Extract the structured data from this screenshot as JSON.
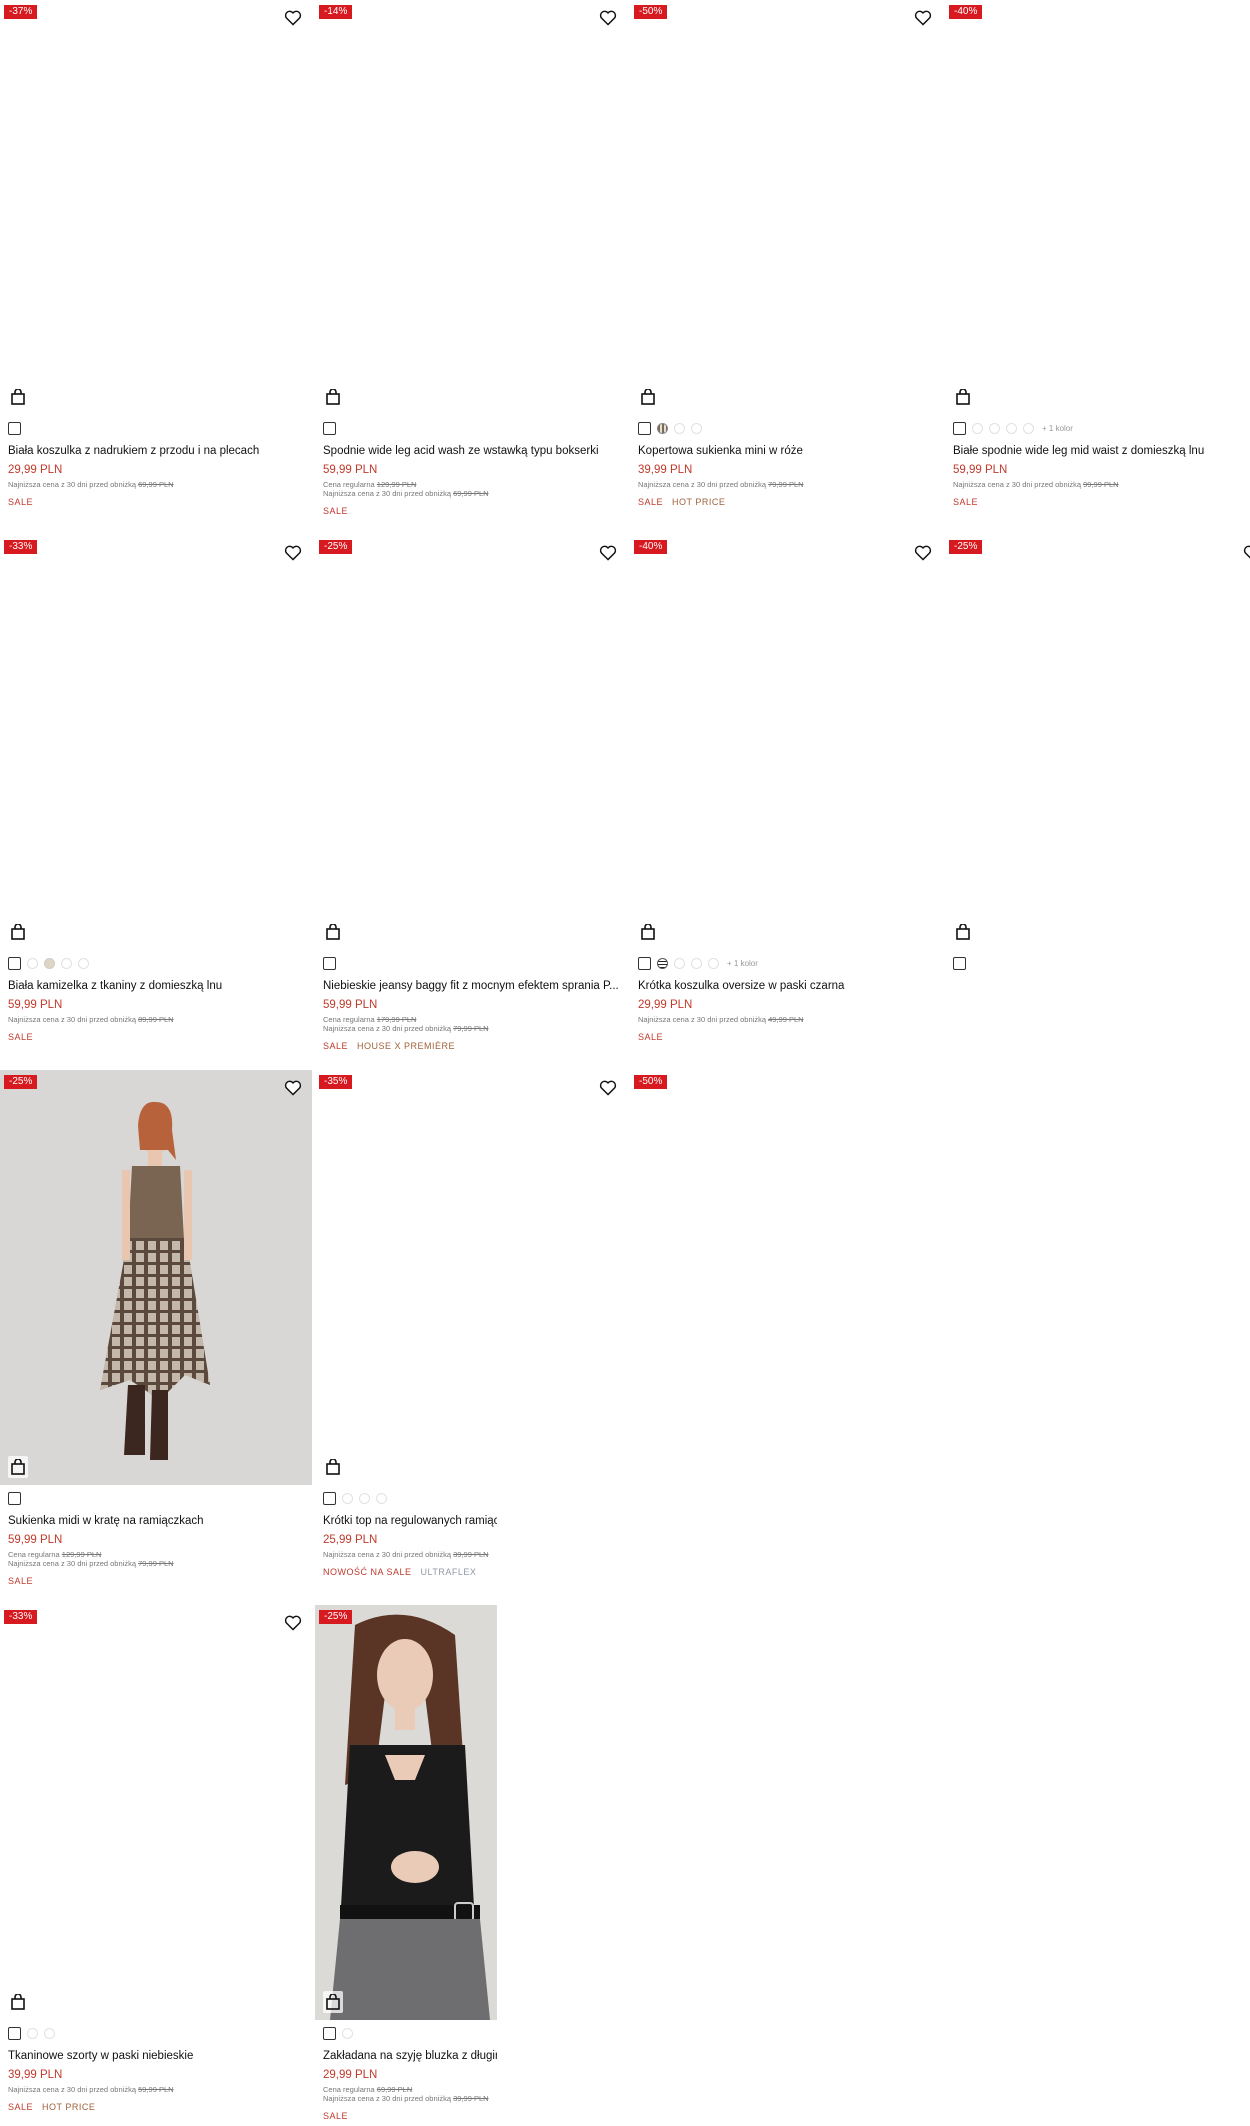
{
  "products": [
    {
      "id": "p1",
      "discount": "-37%",
      "name": "Biała koszulka z nadrukiem z przodu i na plecach",
      "price": "29,99 PLN",
      "regular": "",
      "lowest": "Najniższa cena z 30 dni przed obniżką",
      "lowest_price": "69,99 PLN",
      "more_colors": "",
      "tags": [
        "SALE"
      ]
    },
    {
      "id": "p2",
      "discount": "-14%",
      "name": "Spodnie wide leg acid wash ze wstawką typu bokserki",
      "price": "59,99 PLN",
      "regular_label": "Cena regularna",
      "regular": "129,99 PLN",
      "lowest": "Najniższa cena z 30 dni przed obniżką",
      "lowest_price": "69,99 PLN",
      "more_colors": "",
      "tags": [
        "SALE"
      ]
    },
    {
      "id": "p3",
      "discount": "-50%",
      "name": "Kopertowa sukienka mini w róże",
      "price": "39,99 PLN",
      "regular": "",
      "lowest": "Najniższa cena z 30 dni przed obniżką",
      "lowest_price": "79,99 PLN",
      "more_colors": "",
      "tags": [
        "SALE",
        "HOT PRICE"
      ]
    },
    {
      "id": "p4",
      "discount": "-40%",
      "name": "Białe spodnie wide leg mid waist z domieszką lnu",
      "price": "59,99 PLN",
      "regular": "",
      "lowest": "Najniższa cena z 30 dni przed obniżką",
      "lowest_price": "99,99 PLN",
      "more_colors": "+ 1 kolor",
      "tags": [
        "SALE"
      ]
    },
    {
      "id": "p5",
      "discount": "-33%",
      "name": "Biała kamizelka z tkaniny z domieszką lnu",
      "price": "59,99 PLN",
      "regular": "",
      "lowest": "Najniższa cena z 30 dni przed obniżką",
      "lowest_price": "89,99 PLN",
      "more_colors": "",
      "tags": [
        "SALE"
      ]
    },
    {
      "id": "p6",
      "discount": "-25%",
      "name": "Niebieskie jeansy baggy fit z mocnym efektem sprania P...",
      "price": "59,99 PLN",
      "regular_label": "Cena regularna",
      "regular": "179,99 PLN",
      "lowest": "Najniższa cena z 30 dni przed obniżką",
      "lowest_price": "79,99 PLN",
      "more_colors": "",
      "tags": [
        "SALE",
        "HOUSE X PREMIÈRE"
      ]
    },
    {
      "id": "p7",
      "discount": "-40%",
      "name": "Krótka koszulka oversize w paski czarna",
      "price": "29,99 PLN",
      "regular": "",
      "lowest": "Najniższa cena z 30 dni przed obniżką",
      "lowest_price": "49,99 PLN",
      "more_colors": "+ 1 kolor",
      "tags": [
        "SALE"
      ]
    },
    {
      "id": "p8",
      "discount": "-25%"
    },
    {
      "id": "p9",
      "discount": "-25%",
      "name": "Sukienka midi w kratę na ramiączkach",
      "price": "59,99 PLN",
      "regular_label": "Cena regularna",
      "regular": "129,99 PLN",
      "lowest": "Najniższa cena z 30 dni przed obniżką",
      "lowest_price": "79,99 PLN",
      "more_colors": "",
      "tags": [
        "SALE"
      ]
    },
    {
      "id": "p10",
      "discount": "-35%",
      "name": "Krótki top na regulowanych ramiąc",
      "price": "25,99 PLN",
      "regular": "",
      "lowest": "Najniższa cena z 30 dni przed obniżką",
      "lowest_price": "39,99 PLN",
      "more_colors": "",
      "tags": [
        "NOWOŚĆ NA SALE",
        "ULTRAFLEX"
      ]
    },
    {
      "id": "p11",
      "discount": "-50%"
    },
    {
      "id": "p12",
      "discount": "-33%",
      "name": "Tkaninowe szorty w paski niebieskie",
      "price": "39,99 PLN",
      "regular": "",
      "lowest": "Najniższa cena z 30 dni przed obniżką",
      "lowest_price": "59,99 PLN",
      "more_colors": "",
      "tags": [
        "SALE",
        "HOT PRICE"
      ]
    },
    {
      "id": "p13",
      "discount": "-25%",
      "name": "Zakładana na szyję bluzka z długim",
      "price": "29,99 PLN",
      "regular_label": "Cena regularna",
      "regular": "69,99 PLN",
      "lowest": "Najniższa cena z 30 dni przed obniżką",
      "lowest_price": "39,99 PLN",
      "more_colors": "",
      "tags": [
        "SALE"
      ]
    }
  ],
  "colors": {
    "sale_red": "#d71920",
    "price_red": "#c0392b",
    "brown_tag": "#a0623b",
    "grey_tag": "#8f9aa6"
  },
  "icons": {
    "wishlist": "heart-icon",
    "cart": "shopping-bag-icon"
  }
}
